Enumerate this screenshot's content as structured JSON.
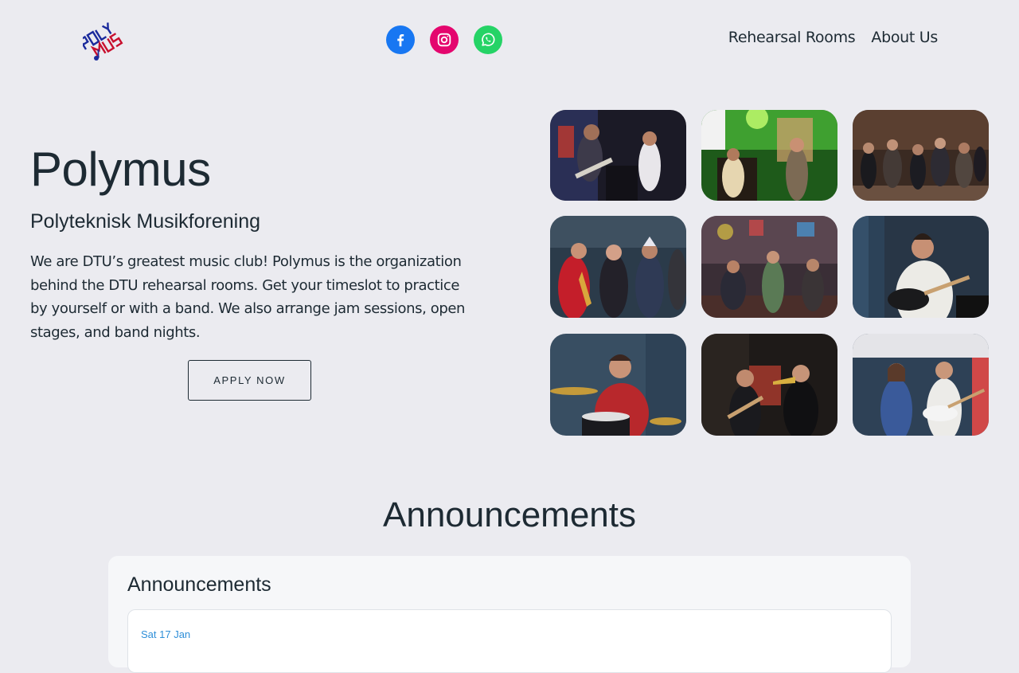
{
  "header": {
    "logo_text": "POLY MUS",
    "social": [
      {
        "name": "facebook",
        "icon": "facebook-icon",
        "color": "#1877f2"
      },
      {
        "name": "instagram",
        "icon": "instagram-icon",
        "color": "#e4066e"
      },
      {
        "name": "whatsapp",
        "icon": "whatsapp-icon",
        "color": "#25d366"
      }
    ],
    "nav": {
      "rehearsal_rooms": "Rehearsal Rooms",
      "about_us": "About Us"
    }
  },
  "hero": {
    "title": "Polymus",
    "subtitle": "Polyteknisk Musikforening",
    "description": "We are DTU’s greatest music club! Polymus is the organization behind the DTU rehearsal rooms. Get your timeslot to practice by yourself or with a band. We also arrange jam sessions, open stages, and band nights.",
    "apply_label": "APPLY NOW"
  },
  "gallery": {
    "photos": [
      "band-guitar-concert-photo",
      "green-stage-concert-photo",
      "dance-crowd-photo",
      "saxophone-singers-photo",
      "jam-session-photo",
      "guitarist-rehearsal-photo",
      "drummer-photo",
      "trumpet-guitar-duo-photo",
      "singer-guitarist-duo-photo"
    ]
  },
  "announcements": {
    "heading": "Announcements",
    "card_title": "Announcements",
    "items": [
      {
        "date": "Sat 17 Jan"
      }
    ]
  },
  "colors": {
    "background": "#ebebf0",
    "text": "#1d2a33",
    "accent_link": "#2f8fd8"
  }
}
